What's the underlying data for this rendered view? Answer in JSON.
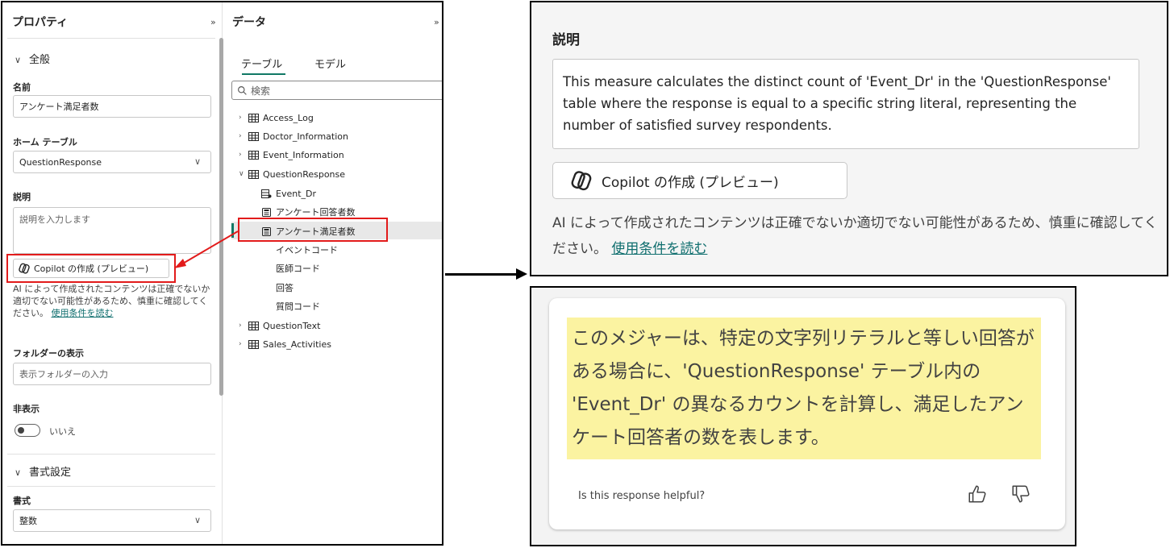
{
  "properties": {
    "title": "プロパティ",
    "collapse": "»",
    "general_section": "全般",
    "name_label": "名前",
    "name_value": "アンケート満足者数",
    "home_table_label": "ホーム テーブル",
    "home_table_value": "QuestionResponse",
    "description_label": "説明",
    "description_placeholder": "説明を入力します",
    "copilot_button": "Copilot の作成 (プレビュー)",
    "disclaimer": "AI によって作成されたコンテンツは正確でないか適切でない可能性があるため、慎重に確認してください。",
    "terms_link": "使用条件を読む",
    "folder_label": "フォルダーの表示",
    "folder_placeholder": "表示フォルダーの入力",
    "hidden_label": "非表示",
    "hidden_value": "いいえ",
    "format_section": "書式設定",
    "format_label": "書式",
    "format_value": "整数"
  },
  "data_pane": {
    "title": "データ",
    "collapse": "»",
    "tabs": [
      "テーブル",
      "モデル"
    ],
    "search_placeholder": "検索",
    "tables": [
      {
        "name": "Access_Log"
      },
      {
        "name": "Doctor_Information"
      },
      {
        "name": "Event_Information"
      },
      {
        "name": "QuestionResponse"
      }
    ],
    "fields": [
      "Event_Dr",
      "アンケート回答者数",
      "アンケート満足者数",
      "イベントコード",
      "医師コード",
      "回答",
      "質問コード"
    ],
    "tables_after": [
      {
        "name": "QuestionText"
      },
      {
        "name": "Sales_Activities"
      }
    ]
  },
  "zoom_description": {
    "title": "説明",
    "text": "This measure calculates the distinct count of 'Event_Dr' in the 'QuestionResponse' table where the response is equal to a specific string literal, representing the number of satisfied survey respondents.",
    "copilot_button": "Copilot の作成 (プレビュー)",
    "disclaimer": "AI によって作成されたコンテンツは正確でないか適切でない可能性があるため、慎重に確認してください。",
    "terms_link": "使用条件を読む"
  },
  "zoom_response": {
    "text": "このメジャーは、特定の文字列リテラルと等しい回答がある場合に、'QuestionResponse' テーブル内の 'Event_Dr' の異なるカウントを計算し、満足したアンケート回答者の数を表します。",
    "helpful_prompt": "Is this response helpful?"
  },
  "colors": {
    "accent": "#117865",
    "highlight_red": "#e21b1b",
    "response_highlight": "#fbf3a1"
  }
}
